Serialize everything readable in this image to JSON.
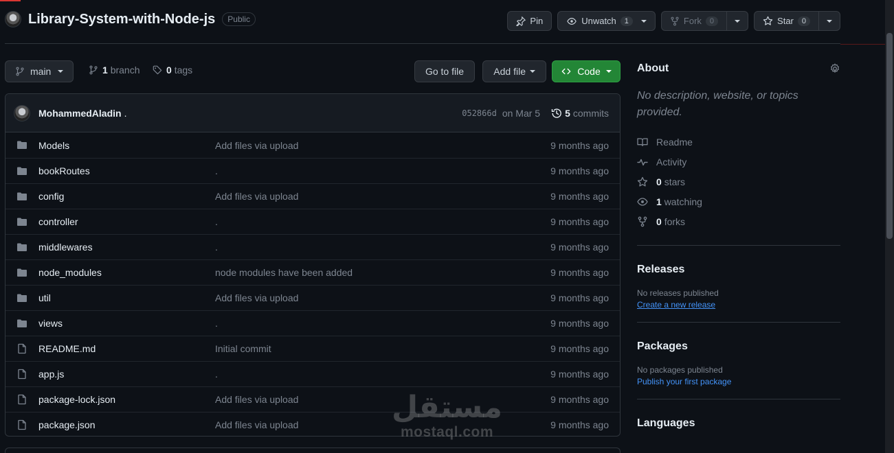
{
  "repo": {
    "name": "Library-System-with-Node-js",
    "visibility": "Public"
  },
  "header": {
    "pin_label": "Pin",
    "unwatch_label": "Unwatch",
    "watch_count": "1",
    "fork_label": "Fork",
    "fork_count": "0",
    "star_label": "Star",
    "star_count": "0"
  },
  "toolbar": {
    "branch": "main",
    "branch_count": "1",
    "branch_label": "branch",
    "tag_count": "0",
    "tag_label": "tags",
    "goto_file": "Go to file",
    "add_file": "Add file",
    "code": "Code"
  },
  "commit": {
    "author": "MohammedAladin",
    "message": ".",
    "sha": "052866d",
    "date": "on Mar 5",
    "count": "5",
    "count_label": "commits"
  },
  "files": [
    {
      "type": "dir",
      "name": "Models",
      "message": "Add files via upload",
      "age": "9 months ago"
    },
    {
      "type": "dir",
      "name": "bookRoutes",
      "message": ".",
      "age": "9 months ago"
    },
    {
      "type": "dir",
      "name": "config",
      "message": "Add files via upload",
      "age": "9 months ago"
    },
    {
      "type": "dir",
      "name": "controller",
      "message": ".",
      "age": "9 months ago"
    },
    {
      "type": "dir",
      "name": "middlewares",
      "message": ".",
      "age": "9 months ago"
    },
    {
      "type": "dir",
      "name": "node_modules",
      "message": "node modules have been added",
      "age": "9 months ago"
    },
    {
      "type": "dir",
      "name": "util",
      "message": "Add files via upload",
      "age": "9 months ago"
    },
    {
      "type": "dir",
      "name": "views",
      "message": ".",
      "age": "9 months ago"
    },
    {
      "type": "file",
      "name": "README.md",
      "message": "Initial commit",
      "age": "9 months ago"
    },
    {
      "type": "file",
      "name": "app.js",
      "message": ".",
      "age": "9 months ago"
    },
    {
      "type": "file",
      "name": "package-lock.json",
      "message": "Add files via upload",
      "age": "9 months ago"
    },
    {
      "type": "file",
      "name": "package.json",
      "message": "Add files via upload",
      "age": "9 months ago"
    }
  ],
  "about": {
    "title": "About",
    "description": "No description, website, or topics provided.",
    "readme": "Readme",
    "activity": "Activity",
    "stars_count": "0",
    "stars_label": "stars",
    "watching_count": "1",
    "watching_label": "watching",
    "forks_count": "0",
    "forks_label": "forks"
  },
  "releases": {
    "title": "Releases",
    "empty": "No releases published",
    "link": "Create a new release"
  },
  "packages": {
    "title": "Packages",
    "empty": "No packages published",
    "link": "Publish your first package"
  },
  "languages": {
    "title": "Languages"
  },
  "watermark": {
    "arabic": "مستقل",
    "latin": "mostaql.com"
  },
  "colors": {
    "background": "#0d1117",
    "code_button": "#238636",
    "link": "#4493f8",
    "muted": "#7d8590"
  }
}
